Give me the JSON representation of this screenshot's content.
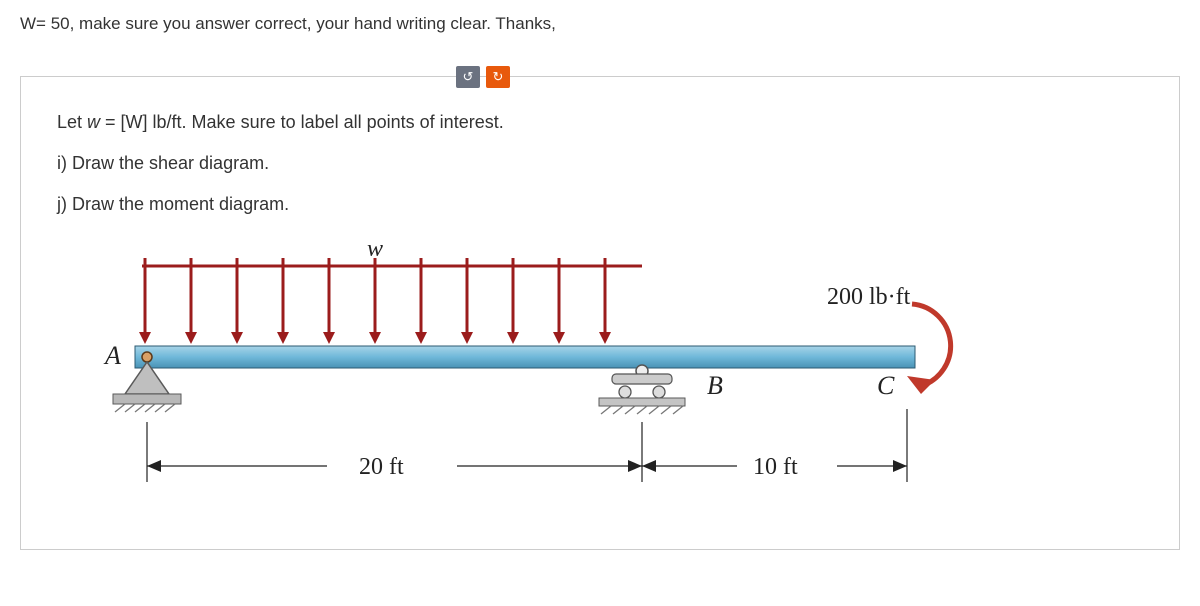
{
  "top_instruction": "W= 50, make sure you answer correct, your hand writing clear. Thanks,",
  "buttons": {
    "undo_icon": "↺",
    "redo_icon": "↻"
  },
  "problem": {
    "line1_pre": "Let ",
    "line1_var": "w",
    "line1_post": " = [W] lb/ft. Make sure to label all points of interest.",
    "line2": "i) Draw the shear diagram.",
    "line3": "j) Draw the moment diagram."
  },
  "diagram": {
    "load_label": "w",
    "moment_label": "200 lb·ft",
    "pointA": "A",
    "pointB": "B",
    "pointC": "C",
    "span1": "20 ft",
    "span2": "10 ft"
  }
}
